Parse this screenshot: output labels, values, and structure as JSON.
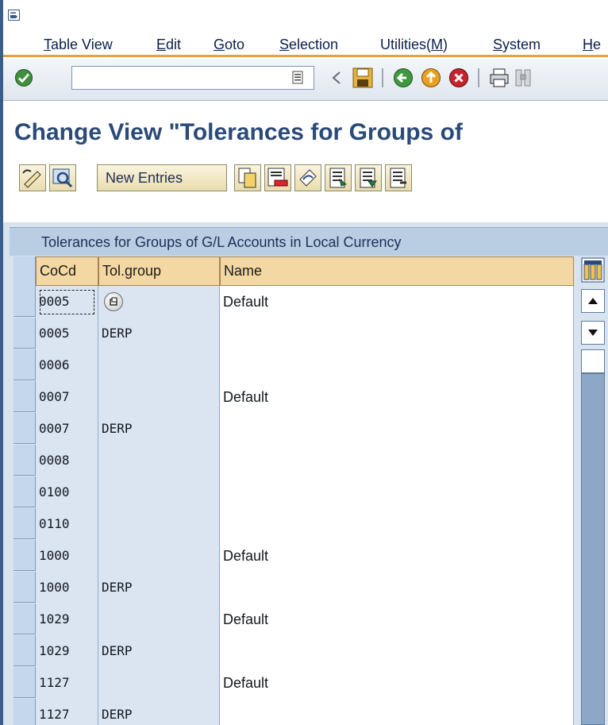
{
  "menu": {
    "items": [
      {
        "label": "Table View",
        "accel": "T",
        "rest": "able View"
      },
      {
        "label": "Edit",
        "accel": "E",
        "rest": "dit"
      },
      {
        "label": "Goto",
        "accel": "G",
        "rest": "oto"
      },
      {
        "label": "Selection",
        "accel": "S",
        "rest": "election"
      },
      {
        "label": "Utilities(M)",
        "pre": "Utilities(",
        "accel": "M",
        "post": ")"
      },
      {
        "label": "System",
        "accel": "S",
        "rest": "ystem"
      },
      {
        "label": "He",
        "accel": "H",
        "rest": "e"
      }
    ]
  },
  "toolbar": {
    "command_field_value": "",
    "icons": [
      "enter-check-icon",
      "command-field-dropdown-icon",
      "collapse-arrow-icon",
      "save-icon",
      "back-icon",
      "exit-icon",
      "cancel-icon",
      "print-icon",
      "find-icon"
    ]
  },
  "title": "Change View \"Tolerances for Groups of",
  "app_toolbar": {
    "icons": [
      "display-change-icon",
      "other-view-icon",
      "copy-as-icon",
      "delete-icon",
      "undo-change-icon",
      "select-all-icon",
      "select-block-icon",
      "deselect-all-icon"
    ],
    "new_entries": "New Entries"
  },
  "table": {
    "title": "Tolerances for Groups of G/L Accounts in Local Currency",
    "columns": [
      "CoCd",
      "Tol.group",
      "Name"
    ],
    "rows": [
      {
        "cocd": "0005",
        "tolgroup": "",
        "name": "Default"
      },
      {
        "cocd": "0005",
        "tolgroup": "DERP",
        "name": ""
      },
      {
        "cocd": "0006",
        "tolgroup": "",
        "name": ""
      },
      {
        "cocd": "0007",
        "tolgroup": "",
        "name": "Default"
      },
      {
        "cocd": "0007",
        "tolgroup": "DERP",
        "name": ""
      },
      {
        "cocd": "0008",
        "tolgroup": "",
        "name": ""
      },
      {
        "cocd": "0100",
        "tolgroup": "",
        "name": ""
      },
      {
        "cocd": "0110",
        "tolgroup": "",
        "name": ""
      },
      {
        "cocd": "1000",
        "tolgroup": "",
        "name": "Default"
      },
      {
        "cocd": "1000",
        "tolgroup": "DERP",
        "name": ""
      },
      {
        "cocd": "1029",
        "tolgroup": "",
        "name": "Default"
      },
      {
        "cocd": "1029",
        "tolgroup": "DERP",
        "name": ""
      },
      {
        "cocd": "1127",
        "tolgroup": "",
        "name": "Default"
      },
      {
        "cocd": "1127",
        "tolgroup": "DERP",
        "name": ""
      }
    ]
  },
  "colors": {
    "title": "#2b4a78",
    "menu_underline": "#e8a13c",
    "header_fill": "#f4d8a3",
    "key_cell_fill": "#dbe5f1"
  }
}
